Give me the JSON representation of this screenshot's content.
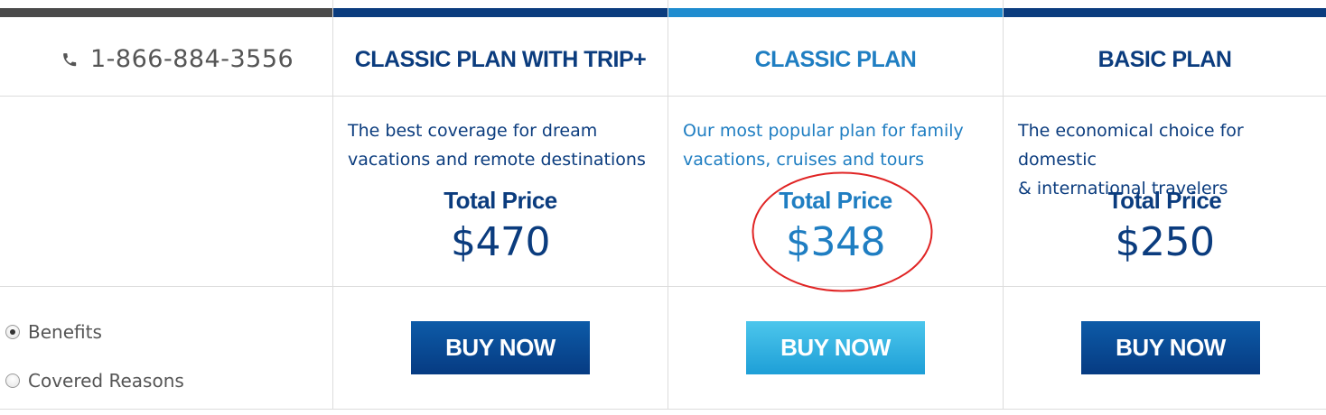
{
  "colors": {
    "dark_blue": "#0b3c7e",
    "light_blue": "#1f8ccf",
    "grey_bar": "#4a4a4a",
    "highlight_red": "#e02424"
  },
  "contact": {
    "icon": "phone-icon",
    "phone": "1-866-884-3556"
  },
  "plans": [
    {
      "title": "CLASSIC PLAN WITH TRIP+",
      "description_lines": [
        "The best coverage for dream",
        "vacations and remote destinations"
      ],
      "price_label": "Total Price",
      "price": "$470",
      "button_label": "BUY NOW",
      "style": "dark"
    },
    {
      "title": "CLASSIC PLAN",
      "description_lines": [
        "Our most popular plan for family",
        "vacations, cruises and tours"
      ],
      "price_label": "Total Price",
      "price": "$348",
      "button_label": "BUY NOW",
      "style": "light",
      "highlighted": true
    },
    {
      "title": "BASIC PLAN",
      "description_lines": [
        "The economical choice for domestic",
        "& international travelers"
      ],
      "price_label": "Total Price",
      "price": "$250",
      "button_label": "BUY NOW",
      "style": "dark"
    }
  ],
  "view_options": [
    {
      "label": "Benefits",
      "selected": true
    },
    {
      "label": "Covered Reasons",
      "selected": false
    }
  ]
}
